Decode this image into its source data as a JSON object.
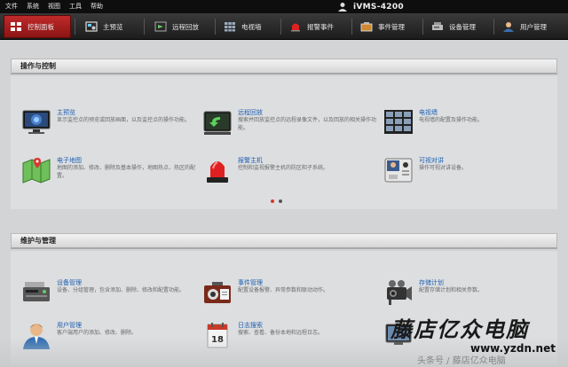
{
  "menubar": {
    "items": [
      "文件",
      "系统",
      "视图",
      "工具",
      "帮助"
    ],
    "title": "iVMS-4200"
  },
  "tabs": [
    {
      "label": "控制面板",
      "icon": "grid-icon",
      "active": true
    },
    {
      "label": "主预览",
      "icon": "camera-preview-icon"
    },
    {
      "label": "远程回放",
      "icon": "playback-icon"
    },
    {
      "label": "电视墙",
      "icon": "video-wall-icon"
    },
    {
      "label": "报警事件",
      "icon": "alarm-icon"
    },
    {
      "label": "事件管理",
      "icon": "event-icon"
    },
    {
      "label": "设备管理",
      "icon": "device-icon"
    },
    {
      "label": "用户管理",
      "icon": "user-icon"
    }
  ],
  "sections": {
    "operation": {
      "title": "操作与控制",
      "items": [
        {
          "name": "主预览",
          "desc": "显示监控点的预览或回放画面，以及监控点的操作功能。",
          "icon": "monitor-icon"
        },
        {
          "name": "远程回放",
          "desc": "搜索并回放监控点的远程录像文件，以及回放的相关操作功能。",
          "icon": "playback-icon"
        },
        {
          "name": "电视墙",
          "desc": "电视墙的配置及操作功能。",
          "icon": "video-wall-icon"
        },
        {
          "name": "电子地图",
          "desc": "地图的添加、修改、删除及基本操作，地图热点、热区的配置。",
          "icon": "map-icon"
        },
        {
          "name": "报警主机",
          "desc": "控制和监视报警主机的防区和子系统。",
          "icon": "siren-icon"
        },
        {
          "name": "可视对讲",
          "desc": "操作可视对讲设备。",
          "icon": "intercom-icon"
        }
      ]
    },
    "maintenance": {
      "title": "维护与管理",
      "items": [
        {
          "name": "设备管理",
          "desc": "设备、分组管理，包含添加、删除、修改和配置功能。",
          "icon": "device-icon"
        },
        {
          "name": "事件管理",
          "desc": "配置设备报警、异常参数和联动动作。",
          "icon": "event-icon"
        },
        {
          "name": "存储计划",
          "desc": "配置存储计划和相关参数。",
          "icon": "storage-icon"
        },
        {
          "name": "用户管理",
          "desc": "客户端用户的添加、修改、删除。",
          "icon": "user-icon"
        },
        {
          "name": "日志搜索",
          "desc": "搜索、查看、备份本地和远程日志。",
          "icon": "log-icon"
        },
        {
          "name": "",
          "desc": "",
          "icon": "system-icon"
        }
      ]
    }
  },
  "pager": {
    "count": 2,
    "active": 0
  },
  "watermark": {
    "main": "藤店亿众电脑",
    "url": "www.yzdn.net",
    "sub": "头条号 / 藤店亿众电脑"
  },
  "colors": {
    "accent": "#b51f1f",
    "link": "#1f5fb0",
    "menubar": "#0e0e0e"
  }
}
